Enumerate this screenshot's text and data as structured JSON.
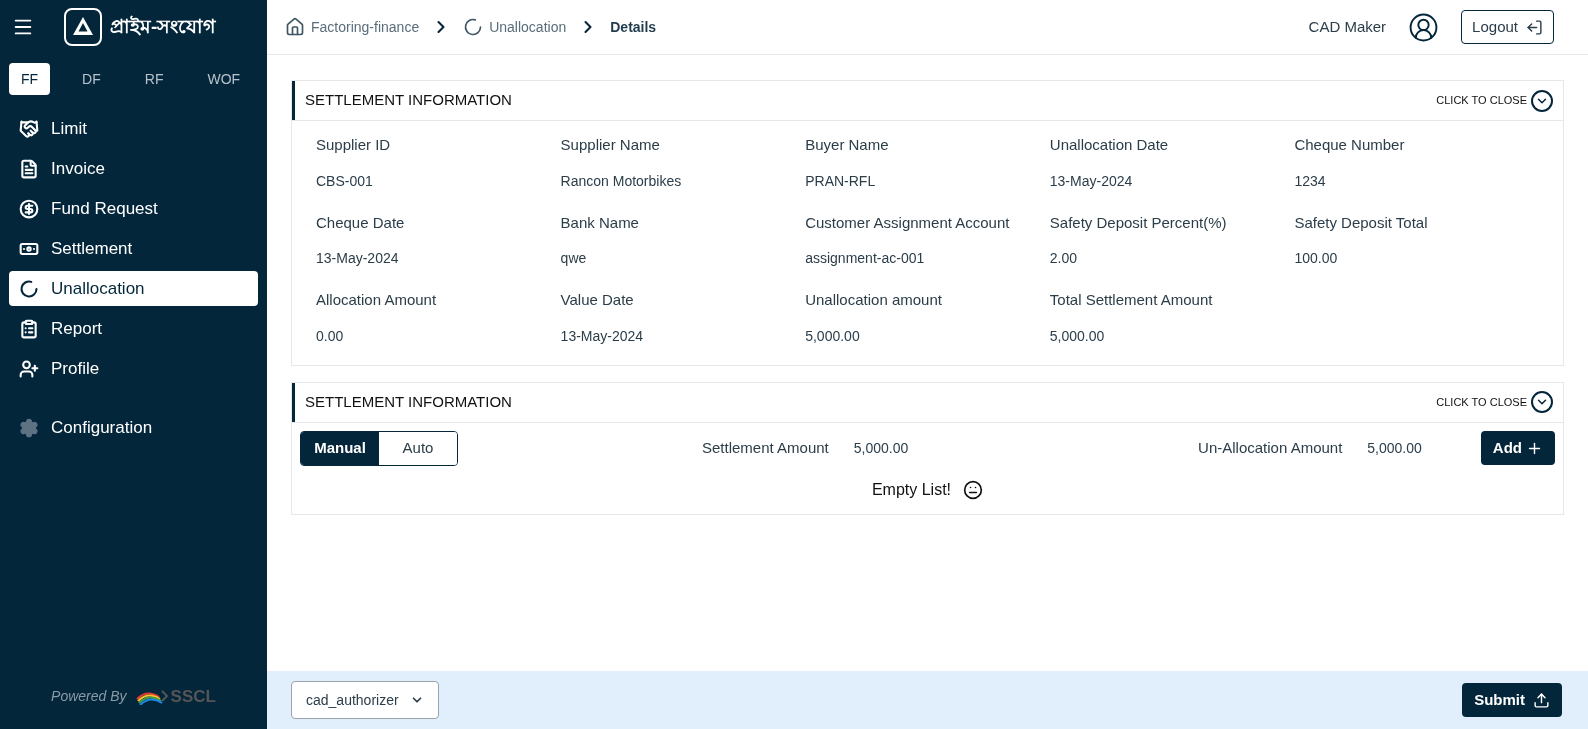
{
  "sidebar": {
    "brand": "প্রাইম-সংযোগ",
    "modules": [
      {
        "label": "FF",
        "selected": true
      },
      {
        "label": "DF",
        "selected": false
      },
      {
        "label": "RF",
        "selected": false
      },
      {
        "label": "WOF",
        "selected": false
      }
    ],
    "nav_items": [
      {
        "label": "Limit",
        "kind": "handshake",
        "selected": false
      },
      {
        "label": "Invoice",
        "kind": "invoice",
        "selected": false
      },
      {
        "label": "Fund Request",
        "kind": "fund",
        "selected": false
      },
      {
        "label": "Settlement",
        "kind": "banknote",
        "selected": false
      },
      {
        "label": "Unallocation",
        "kind": "ring",
        "selected": true
      },
      {
        "label": "Report",
        "kind": "report",
        "selected": false
      },
      {
        "label": "Profile",
        "kind": "profile",
        "selected": false
      }
    ],
    "settings_items": [
      {
        "label": "Configuration",
        "kind": "gear",
        "selected": false
      }
    ],
    "powered_by": "Powered By",
    "vendor": "SSCL"
  },
  "breadcrumb": [
    {
      "label": "Factoring-finance",
      "kind": "home",
      "current": false
    },
    {
      "label": "Unallocation",
      "kind": "ring",
      "current": false
    },
    {
      "label": "Details",
      "kind": "text",
      "current": true
    }
  ],
  "user": {
    "name": "CAD Maker",
    "logout": "Logout"
  },
  "info_section": {
    "title": "SETTLEMENT INFORMATION",
    "toggle": "CLICK TO CLOSE",
    "fields": [
      {
        "label": "Supplier ID",
        "value": "CBS-001"
      },
      {
        "label": "Supplier Name",
        "value": "Rancon Motorbikes"
      },
      {
        "label": "Buyer Name",
        "value": "PRAN-RFL"
      },
      {
        "label": "Unallocation Date",
        "value": "13-May-2024"
      },
      {
        "label": "Cheque Number",
        "value": "1234"
      },
      {
        "label": "Cheque Date",
        "value": "13-May-2024"
      },
      {
        "label": "Bank Name",
        "value": "qwe"
      },
      {
        "label": "Customer Assignment Account",
        "value": "assignment-ac-001"
      },
      {
        "label": "Safety Deposit Percent(%)",
        "value": "2.00"
      },
      {
        "label": "Safety Deposit Total",
        "value": "100.00"
      },
      {
        "label": "Allocation Amount",
        "value": "0.00"
      },
      {
        "label": "Value Date",
        "value": "13-May-2024"
      },
      {
        "label": "Unallocation amount",
        "value": "5,000.00"
      },
      {
        "label": "Total Settlement Amount",
        "value": "5,000.00"
      }
    ]
  },
  "settlement_section": {
    "title": "SETTLEMENT INFORMATION",
    "toggle": "CLICK TO CLOSE",
    "modes": [
      {
        "label": "Manual",
        "selected": true
      },
      {
        "label": "Auto",
        "selected": false
      }
    ],
    "settlement_amount": {
      "label": "Settlement Amount",
      "value": "5,000.00"
    },
    "unallocation_amount": {
      "label": "Un-Allocation Amount",
      "value": "5,000.00"
    },
    "add_button": "Add",
    "empty_message": "Empty List!"
  },
  "footer": {
    "role_select": "cad_authorizer",
    "submit": "Submit"
  }
}
